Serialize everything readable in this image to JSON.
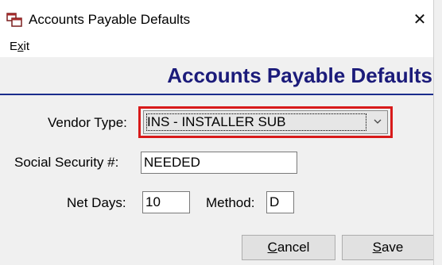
{
  "window": {
    "title": "Accounts Payable Defaults",
    "close_glyph": "✕"
  },
  "menu": {
    "exit_prefix": "E",
    "exit_underlined": "x",
    "exit_suffix": "it"
  },
  "header": {
    "title": "Accounts Payable Defaults"
  },
  "form": {
    "vendor_type_label": "Vendor Type:",
    "vendor_type_value": "INS - INSTALLER SUB",
    "ssn_label": "Social Security #:",
    "ssn_value": "NEEDED",
    "net_days_label": "Net Days:",
    "net_days_value": "10",
    "method_label": "Method:",
    "method_value": "D"
  },
  "buttons": {
    "cancel_underlined": "C",
    "cancel_rest": "ancel",
    "save_underlined": "S",
    "save_rest": "ave"
  },
  "colors": {
    "header_text": "#1b1b7a",
    "highlight_border": "#d81a1a",
    "form_bg": "#f0f0f0"
  },
  "icons": {
    "app": "app-window-icon",
    "close": "close-icon",
    "dropdown": "chevron-down-icon"
  }
}
